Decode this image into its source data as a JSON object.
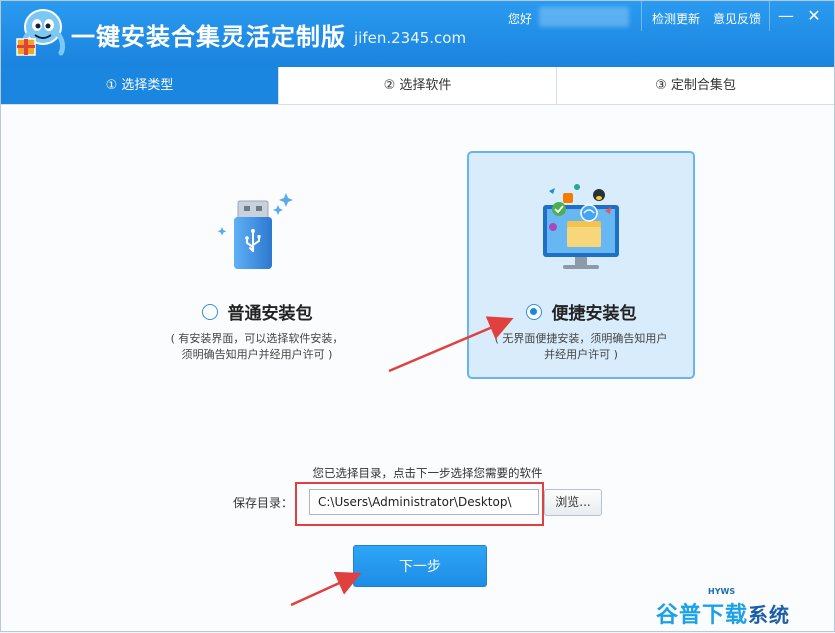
{
  "titlebar": {
    "title": "一键安装合集灵活定制版",
    "site": "jifen.2345.com",
    "greeting": "您好",
    "check_update": "检测更新",
    "feedback": "意见反馈",
    "minimize_glyph": "—",
    "close_glyph": "✕"
  },
  "steps": [
    {
      "label": "① 选择类型",
      "active": true
    },
    {
      "label": "② 选择软件",
      "active": false
    },
    {
      "label": "③ 定制合集包",
      "active": false
    }
  ],
  "options": {
    "normal": {
      "label": "普通安装包",
      "desc_line1": "( 有安装界面，可以选择软件安装，",
      "desc_line2": "须明确告知用户并经用户许可 )",
      "selected": false,
      "icon": "usb-drive-icon"
    },
    "quick": {
      "label": "便捷安装包",
      "desc_line1": "( 无界面便捷安装，须明确告知用户",
      "desc_line2": "并经用户许可 )",
      "selected": true,
      "icon": "monitor-apps-icon"
    }
  },
  "save": {
    "hint": "您已选择目录，点击下一步选择您需要的软件",
    "label": "保存目录：",
    "path": "C:\\Users\\Administrator\\Desktop\\",
    "browse_label": "浏览..."
  },
  "next_label": "下一步",
  "watermark": {
    "text": "谷普下载",
    "text2": "系统",
    "tag": "HYWS"
  },
  "colors": {
    "titlebar": "#1a86e0",
    "accent": "#1a86e0",
    "annotation": "#e0413f"
  }
}
